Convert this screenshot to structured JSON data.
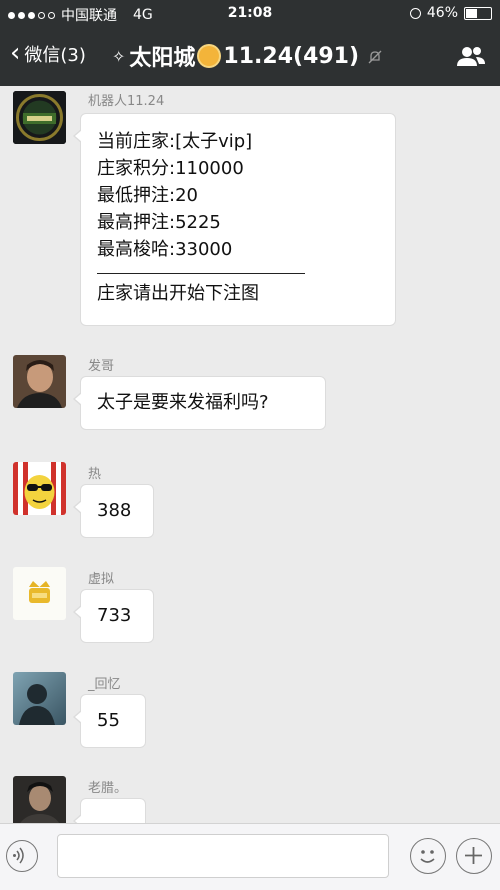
{
  "status_bar": {
    "carrier": "中国联通",
    "network": "4G",
    "time": "21:08",
    "battery": "46%",
    "battery_level": 0.46,
    "signal_bars_filled": 3,
    "signal_bars_total": 5
  },
  "nav_bar": {
    "back_label": "微信(3)",
    "title_prefix": "✧",
    "title_main": "太阳城",
    "title_suffix": "11.24(491)",
    "icons": [
      "back-chevron-icon",
      "sun-emoji-icon",
      "mute-icon",
      "group-contacts-icon"
    ]
  },
  "messages": [
    {
      "sender": "机器人11.24",
      "avatar": "robot-avatar",
      "lines": [
        "当前庄家:[太子vip]",
        "庄家积分:110000",
        "最低押注:20",
        "最高押注:5225",
        "最高梭哈:33000"
      ],
      "footer": "庄家请出开始下注图"
    },
    {
      "sender": "发哥",
      "avatar": "man-portrait-avatar",
      "text": "太子是要来发福利吗?"
    },
    {
      "sender": "热",
      "avatar": "cartoon-sunglasses-avatar",
      "text": "388"
    },
    {
      "sender": "虚拟",
      "avatar": "gold-crown-avatar",
      "text": "733"
    },
    {
      "sender": "_回忆",
      "avatar": "silhouette-avatar",
      "text": "55"
    },
    {
      "sender": "老腊。",
      "avatar": "dark-portrait-avatar",
      "text": ""
    }
  ],
  "input_bar": {
    "placeholder": "",
    "icons": [
      "voice-icon",
      "emoji-icon",
      "plus-icon"
    ]
  },
  "colors": {
    "header_bg": "#2e3132",
    "chat_bg": "#ebebeb",
    "bubble_bg": "#ffffff"
  }
}
